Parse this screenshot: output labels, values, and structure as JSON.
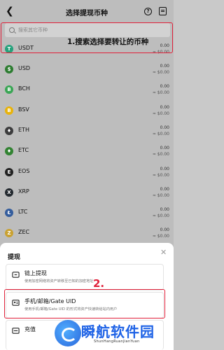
{
  "header": {
    "title": "选择提现币种",
    "help_icon": "question-circle-icon",
    "record_icon": "record-list-icon"
  },
  "search": {
    "placeholder": "搜索其它币种"
  },
  "annotations": {
    "step1": "1.搜索选择要转让的币种",
    "step2": "2."
  },
  "coins": [
    {
      "symbol": "USDT",
      "v1": "0.00",
      "v2": "≈ $0.00",
      "color": "#26a17b"
    },
    {
      "symbol": "USD",
      "v1": "0.00",
      "v2": "≈ $0.00",
      "color": "#2e7d32"
    },
    {
      "symbol": "BCH",
      "v1": "0.00",
      "v2": "≈ $0.00",
      "color": "#3aa655"
    },
    {
      "symbol": "BSV",
      "v1": "0.00",
      "v2": "≈ $0.00",
      "color": "#e8b30b"
    },
    {
      "symbol": "ETH",
      "v1": "0.00",
      "v2": "≈ $0.00",
      "color": "#3c3c3d"
    },
    {
      "symbol": "ETC",
      "v1": "0.00",
      "v2": "≈ $0.00",
      "color": "#328332"
    },
    {
      "symbol": "EOS",
      "v1": "0.00",
      "v2": "≈ $0.00",
      "color": "#222222"
    },
    {
      "symbol": "XRP",
      "v1": "0.00",
      "v2": "≈ $0.00",
      "color": "#23292f"
    },
    {
      "symbol": "LTC",
      "v1": "0.00",
      "v2": "≈ $0.00",
      "color": "#345d9d"
    },
    {
      "symbol": "ZEC",
      "v1": "0.00",
      "v2": "≈ $0.00",
      "color": "#c9a131"
    }
  ],
  "sheet": {
    "title": "提现",
    "close_icon": "close-icon",
    "options": [
      {
        "title": "链上提现",
        "desc": "使用加密网络将资产转移至已知的加密地址",
        "icon": "chain-icon"
      },
      {
        "title": "手机/邮箱/Gate UID",
        "desc": "使用手机/邮箱/Gate UID 的形式将资产快速转给站内用户",
        "icon": "user-card-icon"
      },
      {
        "title": "充值",
        "desc": "",
        "icon": "deposit-icon"
      }
    ]
  },
  "watermark": {
    "text": "瞬航软件园",
    "sub": "ShunHangRuanJianYuan"
  }
}
